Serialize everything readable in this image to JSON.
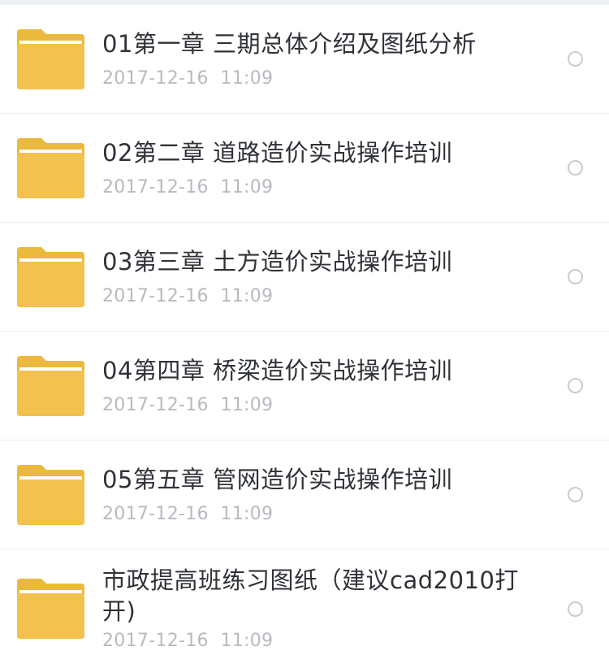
{
  "files": [
    {
      "name": "01第一章 三期总体介绍及图纸分析",
      "date": "2017-12-16  11:09",
      "icon": "folder-icon"
    },
    {
      "name": "02第二章 道路造价实战操作培训",
      "date": "2017-12-16  11:09",
      "icon": "folder-icon"
    },
    {
      "name": "03第三章 土方造价实战操作培训",
      "date": "2017-12-16  11:09",
      "icon": "folder-icon"
    },
    {
      "name": "04第四章 桥梁造价实战操作培训",
      "date": "2017-12-16  11:09",
      "icon": "folder-icon"
    },
    {
      "name": "05第五章 管网造价实战操作培训",
      "date": "2017-12-16  11:09",
      "icon": "folder-icon"
    },
    {
      "name": "市政提高班练习图纸（建议cad2010打开)",
      "date": "2017-12-16  11:09",
      "icon": "folder-icon"
    }
  ],
  "colors": {
    "folder_body": "#f2c14e",
    "folder_tab": "#ecb93f",
    "folder_paper": "#ffffff",
    "title_text": "#2f3338",
    "date_text": "#b7babf",
    "radio_border": "#c9ccd0"
  }
}
